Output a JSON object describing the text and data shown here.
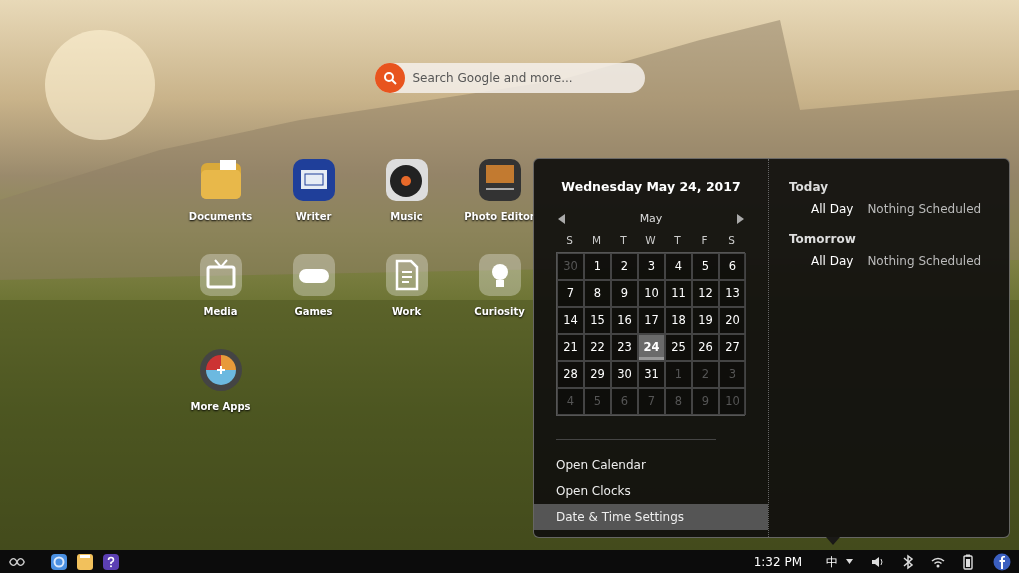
{
  "search": {
    "placeholder": "Search Google and more..."
  },
  "apps": [
    {
      "label": "Documents"
    },
    {
      "label": "Writer"
    },
    {
      "label": "Music"
    },
    {
      "label": "Photo Editor"
    },
    {
      "label": "Media"
    },
    {
      "label": "Games"
    },
    {
      "label": "Work"
    },
    {
      "label": "Curiosity"
    },
    {
      "label": "More Apps"
    }
  ],
  "calendar": {
    "date_title": "Wednesday May 24, 2017",
    "month": "May",
    "weekdays": [
      "S",
      "M",
      "T",
      "W",
      "T",
      "F",
      "S"
    ],
    "days": [
      {
        "label": "30",
        "outside": true,
        "selected": false
      },
      {
        "label": "1",
        "outside": false,
        "selected": false
      },
      {
        "label": "2",
        "outside": false,
        "selected": false
      },
      {
        "label": "3",
        "outside": false,
        "selected": false
      },
      {
        "label": "4",
        "outside": false,
        "selected": false
      },
      {
        "label": "5",
        "outside": false,
        "selected": false
      },
      {
        "label": "6",
        "outside": false,
        "selected": false
      },
      {
        "label": "7",
        "outside": false,
        "selected": false
      },
      {
        "label": "8",
        "outside": false,
        "selected": false
      },
      {
        "label": "9",
        "outside": false,
        "selected": false
      },
      {
        "label": "10",
        "outside": false,
        "selected": false
      },
      {
        "label": "11",
        "outside": false,
        "selected": false
      },
      {
        "label": "12",
        "outside": false,
        "selected": false
      },
      {
        "label": "13",
        "outside": false,
        "selected": false
      },
      {
        "label": "14",
        "outside": false,
        "selected": false
      },
      {
        "label": "15",
        "outside": false,
        "selected": false
      },
      {
        "label": "16",
        "outside": false,
        "selected": false
      },
      {
        "label": "17",
        "outside": false,
        "selected": false
      },
      {
        "label": "18",
        "outside": false,
        "selected": false
      },
      {
        "label": "19",
        "outside": false,
        "selected": false
      },
      {
        "label": "20",
        "outside": false,
        "selected": false
      },
      {
        "label": "21",
        "outside": false,
        "selected": false
      },
      {
        "label": "22",
        "outside": false,
        "selected": false
      },
      {
        "label": "23",
        "outside": false,
        "selected": false
      },
      {
        "label": "24",
        "outside": false,
        "selected": true
      },
      {
        "label": "25",
        "outside": false,
        "selected": false
      },
      {
        "label": "26",
        "outside": false,
        "selected": false
      },
      {
        "label": "27",
        "outside": false,
        "selected": false
      },
      {
        "label": "28",
        "outside": false,
        "selected": false
      },
      {
        "label": "29",
        "outside": false,
        "selected": false
      },
      {
        "label": "30",
        "outside": false,
        "selected": false
      },
      {
        "label": "31",
        "outside": false,
        "selected": false
      },
      {
        "label": "1",
        "outside": true,
        "selected": false
      },
      {
        "label": "2",
        "outside": true,
        "selected": false
      },
      {
        "label": "3",
        "outside": true,
        "selected": false
      },
      {
        "label": "4",
        "outside": true,
        "selected": false
      },
      {
        "label": "5",
        "outside": true,
        "selected": false
      },
      {
        "label": "6",
        "outside": true,
        "selected": false
      },
      {
        "label": "7",
        "outside": true,
        "selected": false
      },
      {
        "label": "8",
        "outside": true,
        "selected": false
      },
      {
        "label": "9",
        "outside": true,
        "selected": false
      },
      {
        "label": "10",
        "outside": true,
        "selected": false
      }
    ]
  },
  "menu": [
    {
      "label": "Open Calendar",
      "selected": false
    },
    {
      "label": "Open Clocks",
      "selected": false
    },
    {
      "label": "Date & Time Settings",
      "selected": true
    }
  ],
  "events": [
    {
      "heading": "Today",
      "time": "All Day",
      "text": "Nothing Scheduled"
    },
    {
      "heading": "Tomorrow",
      "time": "All Day",
      "text": "Nothing Scheduled"
    }
  ],
  "taskbar": {
    "clock": "1:32 PM",
    "input_method": "中"
  }
}
